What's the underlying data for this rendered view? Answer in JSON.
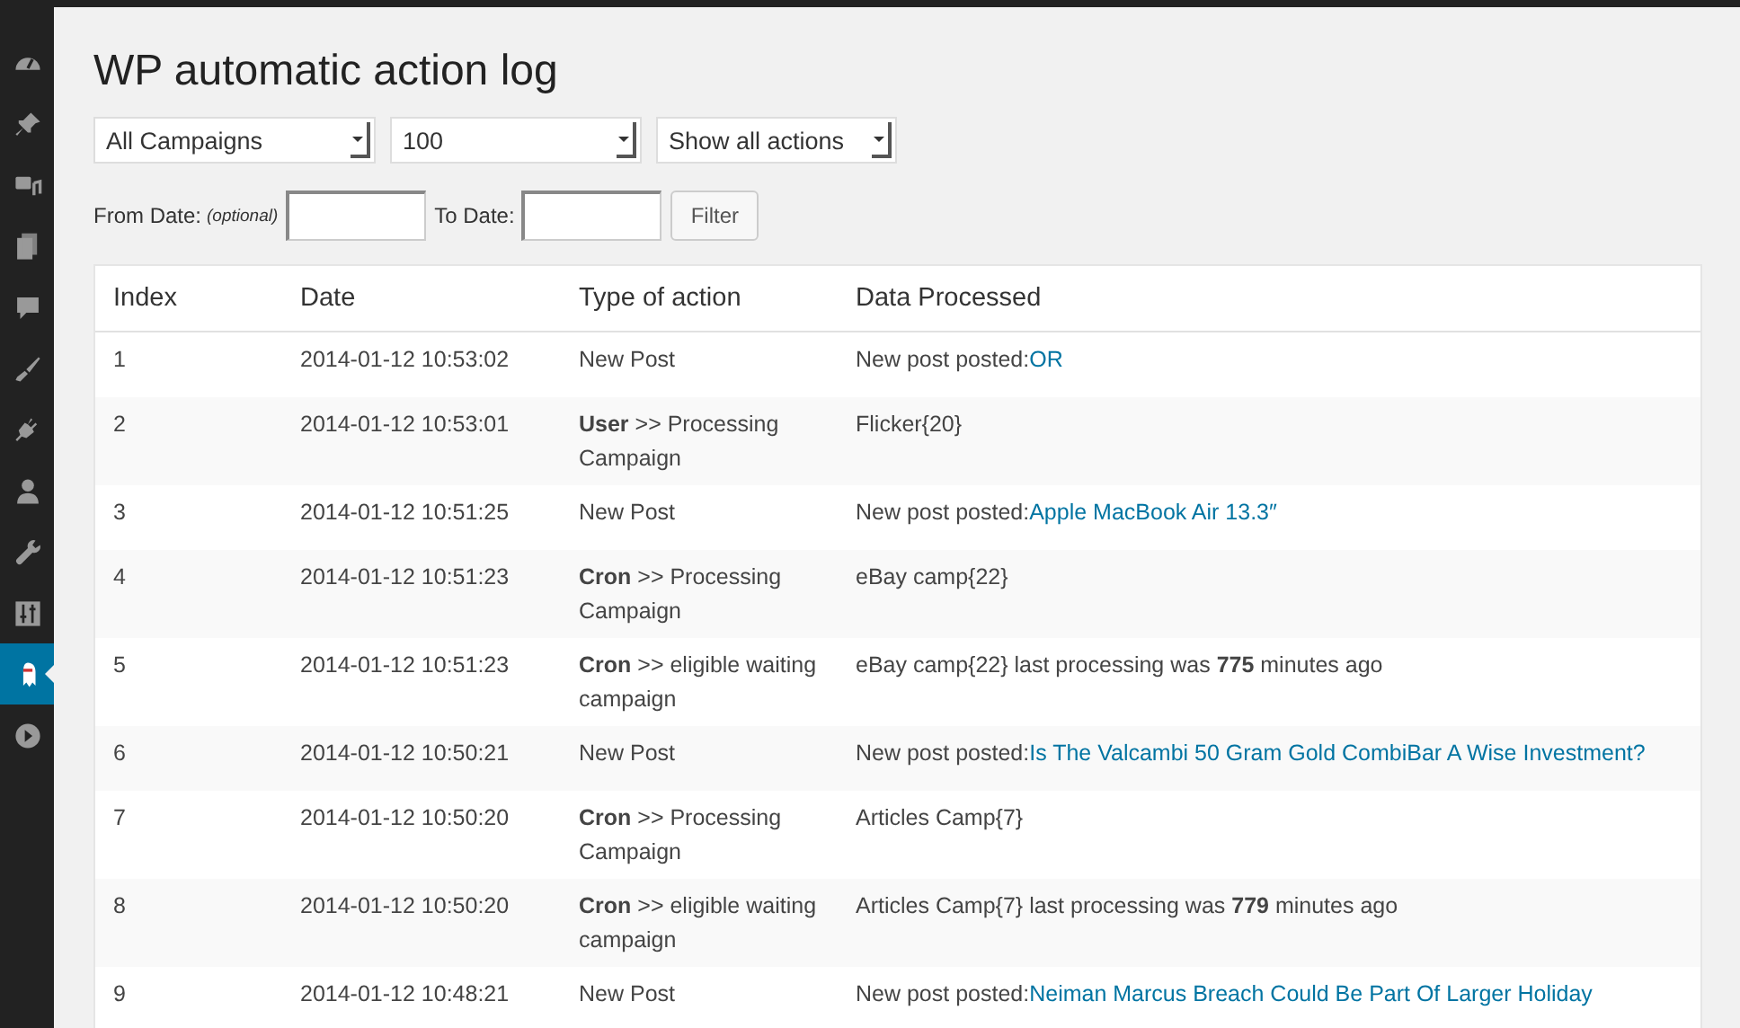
{
  "sidebar": {
    "items": [
      {
        "kind": "dashboard",
        "selected": false
      },
      {
        "kind": "pin",
        "selected": false
      },
      {
        "kind": "media",
        "selected": false
      },
      {
        "kind": "pages",
        "selected": false
      },
      {
        "kind": "comments",
        "selected": false
      },
      {
        "kind": "brush",
        "selected": false
      },
      {
        "kind": "plug",
        "selected": false
      },
      {
        "kind": "user",
        "selected": false
      },
      {
        "kind": "wrench",
        "selected": false
      },
      {
        "kind": "sliders",
        "selected": false
      },
      {
        "kind": "ghost",
        "selected": true
      },
      {
        "kind": "play",
        "selected": false
      }
    ]
  },
  "title": "WP automatic action log",
  "selects": [
    {
      "value": "All Campaigns"
    },
    {
      "value": "100"
    },
    {
      "value": "Show all actions"
    }
  ],
  "date_filter": {
    "fields": [
      {
        "label": "From Date:",
        "hint": "(optional)"
      },
      {
        "label": "To Date:"
      }
    ],
    "button": "Filter"
  },
  "table": {
    "columns": [
      "Index",
      "Date",
      "Type of action",
      "Data Processed"
    ],
    "rows": [
      {
        "index": "1",
        "date": "2014-01-12 10:53:02",
        "type": "New Post",
        "data": "New post posted:",
        "link": "OR"
      },
      {
        "index": "2",
        "date": "2014-01-12 10:53:01",
        "type": "**User** >> Processing Campaign",
        "data": "Flicker{20}"
      },
      {
        "index": "3",
        "date": "2014-01-12 10:51:25",
        "type": "New Post",
        "data": "New post posted:",
        "link": "Apple MacBook Air 13.3″"
      },
      {
        "index": "4",
        "date": "2014-01-12 10:51:23",
        "type": "**Cron** >> Processing Campaign",
        "data": "eBay camp{22}"
      },
      {
        "index": "5",
        "date": "2014-01-12 10:51:23",
        "type": "**Cron** >> eligible waiting campaign",
        "data": "eBay camp{22} last processing was **775** minutes ago"
      },
      {
        "index": "6",
        "date": "2014-01-12 10:50:21",
        "type": "New Post",
        "data": "New post posted:",
        "link": "Is The Valcambi 50 Gram Gold CombiBar A Wise Investment?"
      },
      {
        "index": "7",
        "date": "2014-01-12 10:50:20",
        "type": "**Cron** >> Processing Campaign",
        "data": "Articles Camp{7}"
      },
      {
        "index": "8",
        "date": "2014-01-12 10:50:20",
        "type": "**Cron** >> eligible waiting campaign",
        "data": "Articles Camp{7} last processing was **779** minutes ago"
      },
      {
        "index": "9",
        "date": "2014-01-12 10:48:21",
        "type": "New Post",
        "data": "New post posted:",
        "link": "Neiman Marcus Breach Could Be Part Of Larger Holiday"
      }
    ]
  }
}
